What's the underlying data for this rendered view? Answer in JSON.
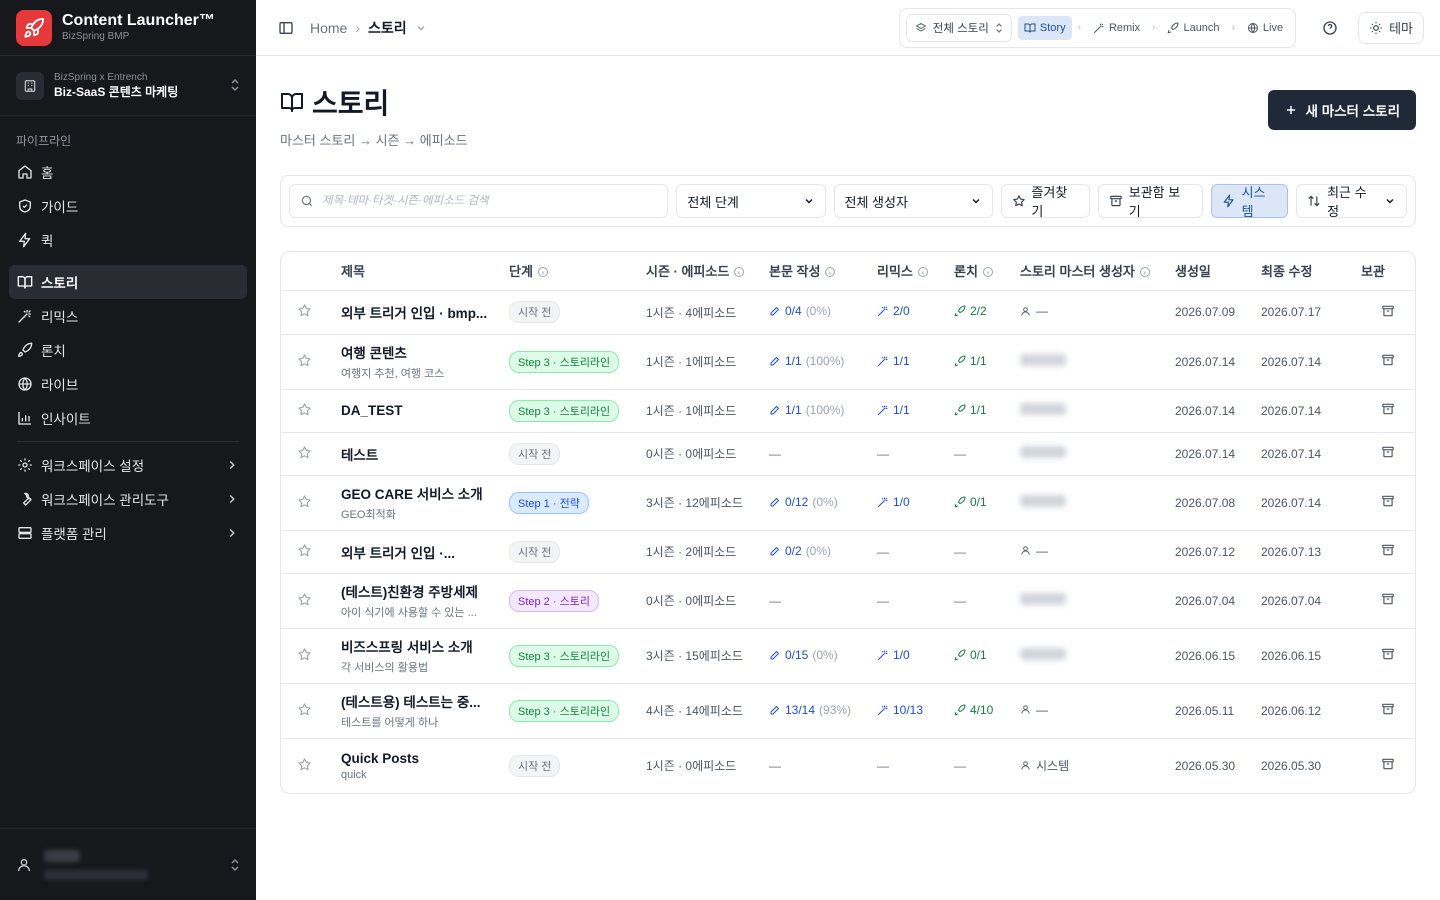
{
  "brand": {
    "title": "Content Launcher™",
    "subtitle": "BizSpring BMP"
  },
  "workspace": {
    "org": "BizSpring x Entrench",
    "name": "Biz-SaaS 콘텐츠 마케팅"
  },
  "sidebar": {
    "section_label": "파이프라인",
    "items": [
      {
        "label": "홈",
        "icon": "home-icon"
      },
      {
        "label": "가이드",
        "icon": "shield-icon"
      },
      {
        "label": "퀵",
        "icon": "zap-icon"
      },
      {
        "label": "스토리",
        "icon": "book-open-icon",
        "active": true
      },
      {
        "label": "리믹스",
        "icon": "wand-icon"
      },
      {
        "label": "론치",
        "icon": "rocket-icon"
      },
      {
        "label": "라이브",
        "icon": "globe-icon"
      },
      {
        "label": "인사이트",
        "icon": "bar-chart-icon"
      }
    ],
    "settings": [
      {
        "label": "워크스페이스 설정",
        "icon": "gear-icon"
      },
      {
        "label": "워크스페이스 관리도구",
        "icon": "wrench-icon"
      },
      {
        "label": "플랫폼 관리",
        "icon": "server-icon"
      }
    ]
  },
  "topbar": {
    "breadcrumb_home": "Home",
    "breadcrumb_current": "스토리",
    "pipeline_select": "전체 스토리",
    "pipeline_steps": [
      "Story",
      "Remix",
      "Launch",
      "Live"
    ],
    "theme_label": "테마"
  },
  "page": {
    "title": "스토리",
    "subtitle": "마스터 스토리 → 시즌 → 에피소드",
    "new_button": "새 마스터 스토리"
  },
  "filters": {
    "search_placeholder": "제목·테마·타겟·시즌·에피소드 검색",
    "stage_select": "전체 단계",
    "creator_select": "전체 생성자",
    "favorites": "즐겨찾기",
    "archive": "보관함 보기",
    "system": "시스템",
    "sort": "최근 수정"
  },
  "table": {
    "headers": {
      "title": "제목",
      "stage": "단계",
      "season_episode": "시즌 · 에피소드",
      "body": "본문 작성",
      "remix": "리믹스",
      "launch": "론치",
      "creator": "스토리 마스터 생성자",
      "created": "생성일",
      "updated": "최종 수정",
      "archive": "보관"
    },
    "rows": [
      {
        "title": "외부 트리거 인입 · bmp...",
        "sub": "",
        "stage": "시작 전",
        "stage_color": "gray",
        "season": "1시즌 · 4에피소드",
        "body": "0/4",
        "body_pct": "(0%)",
        "remix": "2/0",
        "launch": "2/2",
        "creator": "—",
        "creator_type": "person",
        "created": "2026.07.09",
        "updated": "2026.07.17"
      },
      {
        "title": "여행 콘텐츠",
        "sub": "여행지 추천, 여행 코스",
        "stage": "Step 3 · 스토리라인",
        "stage_color": "green",
        "season": "1시즌 · 1에피소드",
        "body": "1/1",
        "body_pct": "(100%)",
        "remix": "1/1",
        "launch": "1/1",
        "creator": "",
        "creator_type": "blur",
        "created": "2026.07.14",
        "updated": "2026.07.14"
      },
      {
        "title": "DA_TEST",
        "sub": "",
        "stage": "Step 3 · 스토리라인",
        "stage_color": "green",
        "season": "1시즌 · 1에피소드",
        "body": "1/1",
        "body_pct": "(100%)",
        "remix": "1/1",
        "launch": "1/1",
        "creator": "",
        "creator_type": "blur",
        "created": "2026.07.14",
        "updated": "2026.07.14"
      },
      {
        "title": "테스트",
        "sub": "",
        "stage": "시작 전",
        "stage_color": "gray",
        "season": "0시즌 · 0에피소드",
        "body": "",
        "body_pct": "",
        "remix": "",
        "launch": "",
        "creator": "",
        "creator_type": "blur",
        "created": "2026.07.14",
        "updated": "2026.07.14"
      },
      {
        "title": "GEO CARE 서비스 소개",
        "sub": "GEO최적화",
        "stage": "Step 1 · 전략",
        "stage_color": "blue",
        "season": "3시즌 · 12에피소드",
        "body": "0/12",
        "body_pct": "(0%)",
        "remix": "1/0",
        "launch": "0/1",
        "creator": "",
        "creator_type": "blur",
        "created": "2026.07.08",
        "updated": "2026.07.14"
      },
      {
        "title": "외부 트리거 인입 ·...",
        "sub": "",
        "stage": "시작 전",
        "stage_color": "gray",
        "season": "1시즌 · 2에피소드",
        "body": "0/2",
        "body_pct": "(0%)",
        "remix": "",
        "launch": "",
        "creator": "—",
        "creator_type": "person",
        "created": "2026.07.12",
        "updated": "2026.07.13"
      },
      {
        "title": "(테스트)친환경 주방세제",
        "sub": "아이 식기에 사용할 수 있는 ...",
        "stage": "Step 2 · 스토리",
        "stage_color": "purple",
        "season": "0시즌 · 0에피소드",
        "body": "",
        "body_pct": "",
        "remix": "",
        "launch": "",
        "creator": "",
        "creator_type": "blur",
        "created": "2026.07.04",
        "updated": "2026.07.04"
      },
      {
        "title": "비즈스프링 서비스 소개",
        "sub": "각 서비스의 활용법",
        "stage": "Step 3 · 스토리라인",
        "stage_color": "green",
        "season": "3시즌 · 15에피소드",
        "body": "0/15",
        "body_pct": "(0%)",
        "remix": "1/0",
        "launch": "0/1",
        "creator": "",
        "creator_type": "blur",
        "created": "2026.06.15",
        "updated": "2026.06.15"
      },
      {
        "title": "(테스트용) 테스트는 중...",
        "sub": "테스트를 어떻게 하나",
        "stage": "Step 3 · 스토리라인",
        "stage_color": "green",
        "season": "4시즌 · 14에피소드",
        "body": "13/14",
        "body_pct": "(93%)",
        "remix": "10/13",
        "launch": "4/10",
        "creator": "—",
        "creator_type": "person",
        "created": "2026.05.11",
        "updated": "2026.06.12"
      },
      {
        "title": "Quick Posts",
        "sub": "quick",
        "stage": "시작 전",
        "stage_color": "gray",
        "season": "1시즌 · 0에피소드",
        "body": "",
        "body_pct": "",
        "remix": "",
        "launch": "",
        "creator": "시스템",
        "creator_type": "person",
        "created": "2026.05.30",
        "updated": "2026.05.30"
      }
    ]
  },
  "colors": {
    "sidebar_bg": "#17181c",
    "brand_red": "#e5393b",
    "accent_blue": "#1d4ed8",
    "launch_green": "#15803d"
  }
}
